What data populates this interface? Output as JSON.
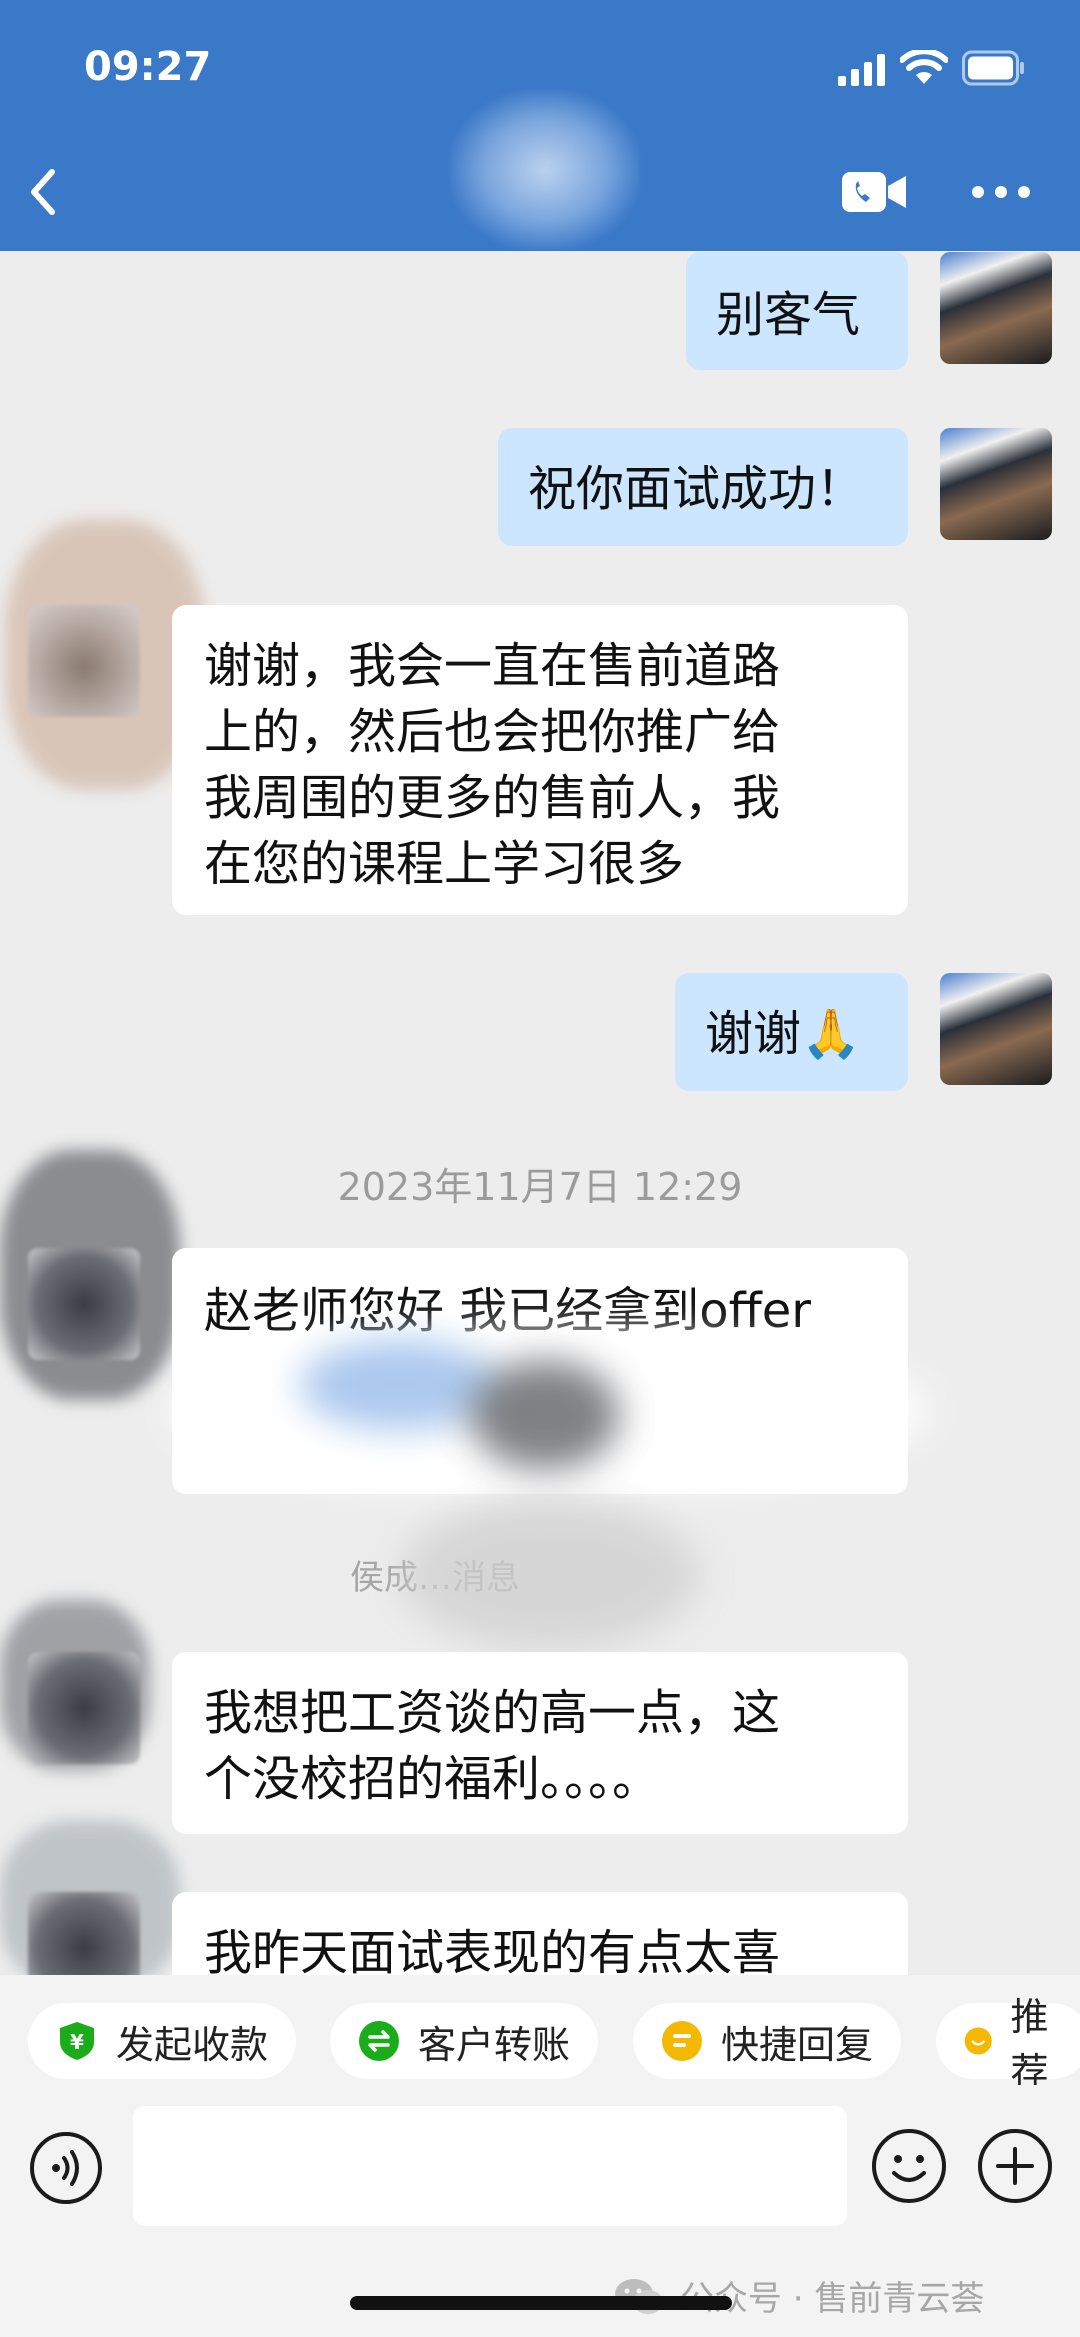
{
  "status_bar": {
    "time": "09:27"
  },
  "header": {
    "title": "",
    "subtitle": ""
  },
  "messages": [
    {
      "side": "me",
      "text": "别客气"
    },
    {
      "side": "me",
      "text": "祝你面试成功！"
    },
    {
      "side": "them",
      "text": "谢谢，我会一直在售前道路\n上的，然后也会把你推广给\n我周围的更多的售前人，我\n在您的课程上学习很多"
    },
    {
      "side": "me",
      "text": "谢谢🙏"
    },
    {
      "side": "them",
      "text": "赵老师您好 我已经拿到offer"
    },
    {
      "side": "them",
      "text": "我想把工资谈的高一点，这\n个没校招的福利。。。。"
    },
    {
      "side": "them",
      "text": "我昨天面试表现的有点太喜"
    }
  ],
  "timestamp": "2023年11月7日 12:29",
  "system_message": "侯成…消息",
  "quick_actions": [
    {
      "label": "发起收款",
      "icon": "yuan-shield-icon",
      "color": "#1AAD19"
    },
    {
      "label": "客户转账",
      "icon": "transfer-icon",
      "color": "#1AAD19"
    },
    {
      "label": "快捷回复",
      "icon": "quick-reply-icon",
      "color": "#F5B800"
    },
    {
      "label": "推荐",
      "icon": "recommend-icon",
      "color": "#F5B800"
    }
  ],
  "watermark": "公众号 · 售前青云荟",
  "colors": {
    "header": "#3A78C8",
    "bubble_me": "#CDE6FF",
    "bubble_them": "#FFFFFF",
    "background": "#EDEDED"
  }
}
